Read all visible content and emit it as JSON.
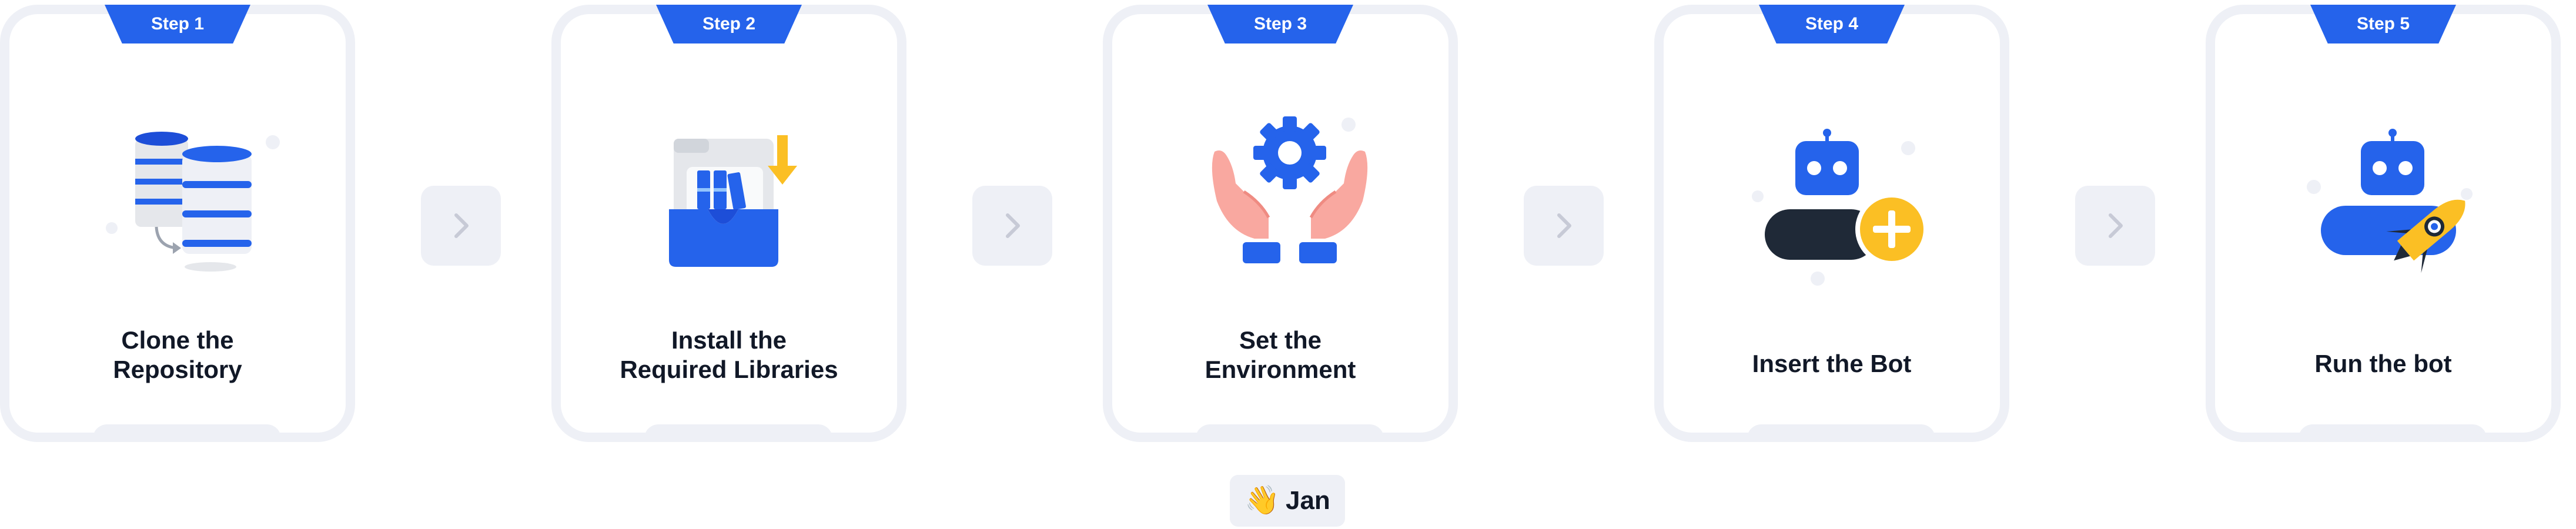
{
  "steps": [
    {
      "tab": "Step 1",
      "lines": [
        "Clone the",
        "Repository"
      ],
      "icon": "database-clone-icon"
    },
    {
      "tab": "Step 2",
      "lines": [
        "Install the",
        "Required Libraries"
      ],
      "icon": "library-tray-icon"
    },
    {
      "tab": "Step 3",
      "lines": [
        "Set the",
        "Environment"
      ],
      "icon": "hands-gear-icon"
    },
    {
      "tab": "Step 4",
      "lines": [
        "Insert the Bot"
      ],
      "icon": "bot-add-icon"
    },
    {
      "tab": "Step 5",
      "lines": [
        "Run the bot"
      ],
      "icon": "bot-rocket-icon"
    }
  ],
  "author": {
    "emoji": "👋",
    "name": "Jan"
  },
  "colors": {
    "accent": "#2563eb",
    "yellow": "#fbbf24",
    "card_border": "#eef0f6",
    "text": "#111827"
  }
}
